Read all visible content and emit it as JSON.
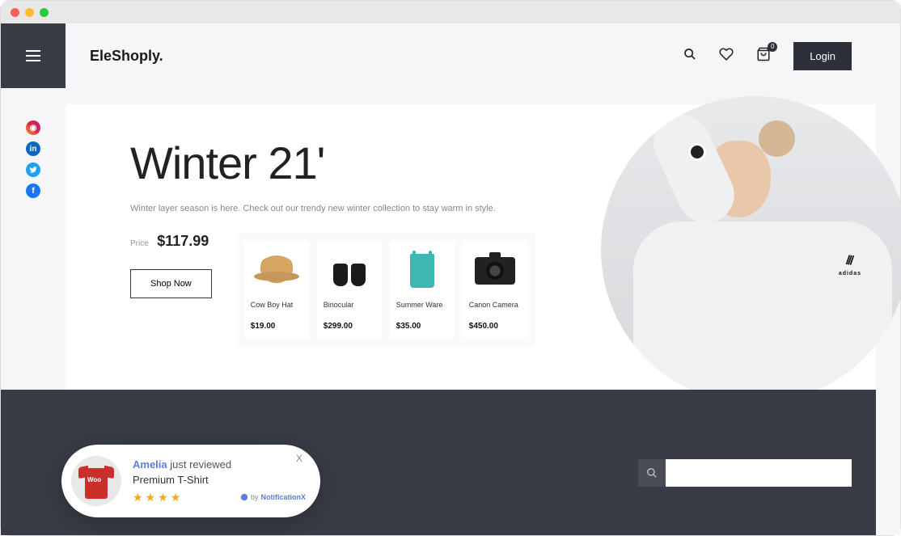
{
  "brand": "EleShoply.",
  "header": {
    "login": "Login",
    "cart_count": "0"
  },
  "hero": {
    "title": "Winter 21'",
    "subtitle": "Winter layer season is here. Check out our trendy new winter collection to stay warm in style.",
    "price_label": "Price",
    "price": "$117.99",
    "shop_now": "Shop Now",
    "model_brand": "adidas"
  },
  "products": [
    {
      "name": "Cow Boy Hat",
      "price": "$19.00"
    },
    {
      "name": "Binocular",
      "price": "$299.00"
    },
    {
      "name": "Summer Ware",
      "price": "$35.00"
    },
    {
      "name": "Canon Camera",
      "price": "$450.00"
    }
  ],
  "notification": {
    "name": "Amelia",
    "action": "just reviewed",
    "product": "Premium T-Shirt",
    "shirt_text": "Woo",
    "rating": 4,
    "credit_by": "by",
    "credit_brand": "NotificationX",
    "close": "X"
  },
  "search": {
    "placeholder": ""
  }
}
